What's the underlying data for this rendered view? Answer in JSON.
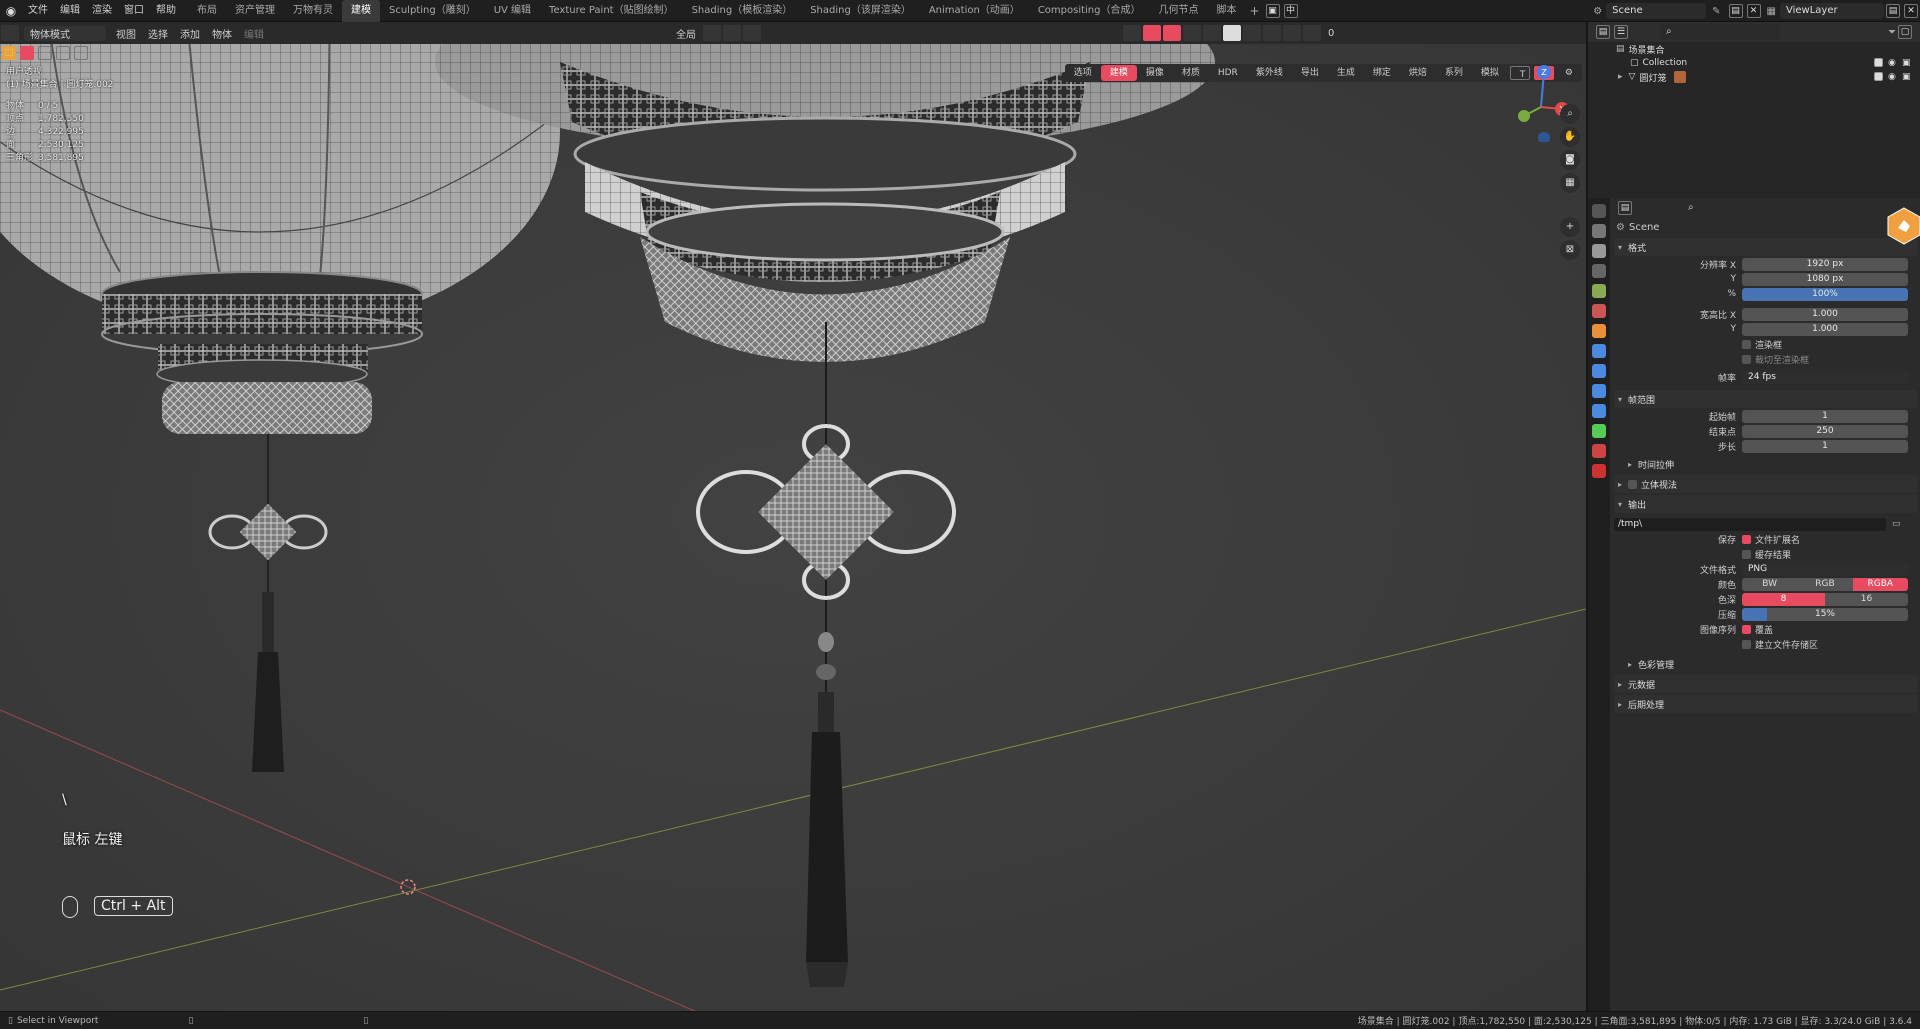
{
  "topbar": {
    "menu": [
      "文件",
      "编辑",
      "渲染",
      "窗口",
      "帮助"
    ],
    "workspaces": [
      "布局",
      "资产管理",
      "万物有灵",
      "建模",
      "Sculpting（雕刻）",
      "UV 编辑",
      "Texture Paint（贴图绘制）",
      "Shading（模板渲染）",
      "Shading（该屏渲染）",
      "Animation（动画）",
      "Compositing（合成）",
      "几何节点",
      "脚本"
    ],
    "active_workspace": "建模",
    "lang_label": "中",
    "scene_name": "Scene",
    "view_layer": "ViewLayer"
  },
  "viewport": {
    "mode": "物体模式",
    "menu": [
      "视图",
      "选择",
      "添加",
      "物体"
    ],
    "edit_label": "编辑",
    "transform_orientation": "全局",
    "view_name": "用户透视",
    "collection_path": "(1) 场景集合 | 圆灯笼.002",
    "stats": [
      {
        "k": "物体",
        "v": "0 / 5"
      },
      {
        "k": "顶点",
        "v": "1,782,550"
      },
      {
        "k": "边",
        "v": "4,322,995"
      },
      {
        "k": "面",
        "v": "2,530,125"
      },
      {
        "k": "三角形",
        "v": "3,581,895"
      }
    ],
    "overlay_select": "选项",
    "addon_tabs": [
      "建模",
      "摄像",
      "材质",
      "HDR",
      "紫外线",
      "导出",
      "生成",
      "绑定",
      "烘焙",
      "系列",
      "模拟"
    ],
    "active_addon_tab": "建模",
    "overlay_count": "0",
    "keyhint_char": "\\",
    "keyhint_mouse": "鼠标 左键",
    "keyhint_keys": "Ctrl + Alt",
    "gizmo": {
      "z": "Z",
      "x": "X"
    }
  },
  "outliner": {
    "root": "场景集合",
    "items": [
      "Collection",
      "圆灯笼"
    ]
  },
  "properties": {
    "scene": "Scene",
    "format_section": "格式",
    "resolution_x_label": "分辨率 X",
    "resolution_x": "1920 px",
    "y_label": "Y",
    "resolution_y": "1080 px",
    "percent_label": "%",
    "percent": "100%",
    "aspect_x_label": "宽高比 X",
    "aspect_x": "1.000",
    "aspect_y": "1.000",
    "render_region": "渲染框",
    "crop_region": "裁切至渲染框",
    "fps_label": "帧率",
    "fps": "24 fps",
    "frame_range_section": "帧范围",
    "start_label": "起始帧",
    "start": "1",
    "end_label": "结束点",
    "end": "250",
    "step_label": "步长",
    "step": "1",
    "time_stretch": "时间拉伸",
    "stereoscopy": "立体视法",
    "output_section": "输出",
    "output_path": "/tmp\\",
    "save_label": "保存",
    "file_ext": "文件扩展名",
    "cache_result": "缓存结果",
    "file_format_label": "文件格式",
    "file_format": "PNG",
    "color_label": "颜色",
    "color_modes": [
      "BW",
      "RGB",
      "RGBA"
    ],
    "color_active": "RGBA",
    "depth_label": "色深",
    "depth": [
      "8",
      "16"
    ],
    "compression_label": "压缩",
    "compression": "15%",
    "compression_fraction": 0.15,
    "image_seq_label": "图像序列",
    "overwrite": "覆盖",
    "placeholders": "建立文件存储区",
    "color_management": "色彩管理",
    "metadata": "元数据",
    "post_processing": "后期处理"
  },
  "statusbar": {
    "left": "Select in Viewport",
    "right": "场景集合 | 圆灯笼.002 | 顶点:1,782,550 | 面:2,530,125 | 三角面:3,581,895 | 物体:0/5 | 内存: 1.73 GiB | 显存: 3.3/24.0 GiB | 3.6.4"
  },
  "colors": {
    "accent": "#e84a5f",
    "blue": "#4772b3",
    "viewport_bg": "#3b3b3b"
  }
}
